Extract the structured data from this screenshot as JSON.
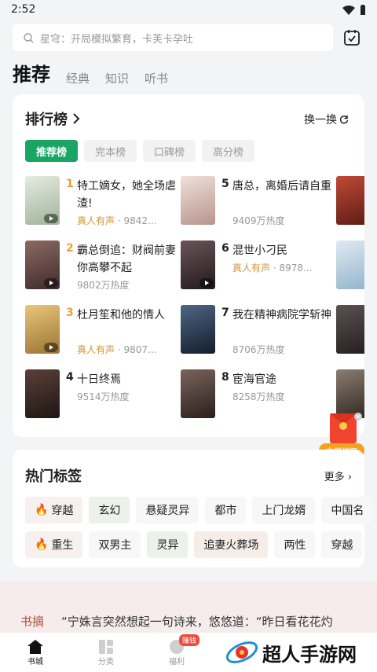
{
  "status": {
    "time": "2:52"
  },
  "search": {
    "placeholder": "星穹：开局模拟繁育，卡芙卡孕吐"
  },
  "tabs": [
    {
      "label": "推荐"
    },
    {
      "label": "经典"
    },
    {
      "label": "知识"
    },
    {
      "label": "听书"
    }
  ],
  "ranking": {
    "title": "排行榜",
    "swap": "换一换",
    "chips": [
      {
        "label": "推荐榜"
      },
      {
        "label": "完本榜"
      },
      {
        "label": "口碑榜"
      },
      {
        "label": "高分榜"
      }
    ],
    "items": [
      {
        "num": "1",
        "title": "特工嫡女，她全场虐渣!",
        "voice": "真人有声",
        "meta": " · 9842...",
        "cover": "#c9d2c0",
        "audio": true
      },
      {
        "num": "2",
        "title": "霸总倒追：财阀前妻你高攀不起",
        "voice": "",
        "meta": "9802万热度",
        "cover": "#6b4b48",
        "audio": true
      },
      {
        "num": "3",
        "title": "杜月笙和他的情人",
        "voice": "真人有声",
        "meta": " · 9807...",
        "cover": "#d7b067",
        "audio": true
      },
      {
        "num": "4",
        "title": "十日终焉",
        "voice": "",
        "meta": "9514万热度",
        "cover": "#3a2b26",
        "audio": false
      },
      {
        "num": "5",
        "title": "唐总，离婚后请自重",
        "voice": "",
        "meta": "9409万热度",
        "cover": "#d8c7c3",
        "audio": false
      },
      {
        "num": "6",
        "title": "混世小刁民",
        "voice": "真人有声",
        "meta": " · 8978...",
        "cover": "#3c3337",
        "audio": true
      },
      {
        "num": "7",
        "title": "我在精神病院学斩神",
        "voice": "",
        "meta": "8706万热度",
        "cover": "#2e3f56",
        "audio": false
      },
      {
        "num": "8",
        "title": "宦海官途",
        "voice": "",
        "meta": "8258万热度",
        "cover": "#4a3c38",
        "audio": false
      }
    ]
  },
  "hot": {
    "title": "热门标签",
    "more": "更多",
    "row1": [
      {
        "label": "穿越",
        "fire": true
      },
      {
        "label": "玄幻"
      },
      {
        "label": "悬疑灵异"
      },
      {
        "label": "都市"
      },
      {
        "label": "上门龙婿"
      },
      {
        "label": "中国名"
      }
    ],
    "row2": [
      {
        "label": "重生",
        "fire": true
      },
      {
        "label": "双男主"
      },
      {
        "label": "灵异"
      },
      {
        "label": "追妻火葬场"
      },
      {
        "label": "两性"
      },
      {
        "label": "穿越"
      }
    ]
  },
  "redpack": {
    "label": "立即领取"
  },
  "digest": {
    "label": "书摘",
    "quote": "“宁姝言突然想起一句诗来，悠悠道：“昨日看花花灼"
  },
  "nav": [
    {
      "label": "书城"
    },
    {
      "label": "分类"
    },
    {
      "label": "福利",
      "badge": "赚钱"
    },
    {
      "label": ""
    },
    {
      "label": ""
    }
  ],
  "watermark": "超人手游网",
  "colors": {
    "accent": "#19a564",
    "voice": "#d39434",
    "redpack": "#f4a21c"
  }
}
